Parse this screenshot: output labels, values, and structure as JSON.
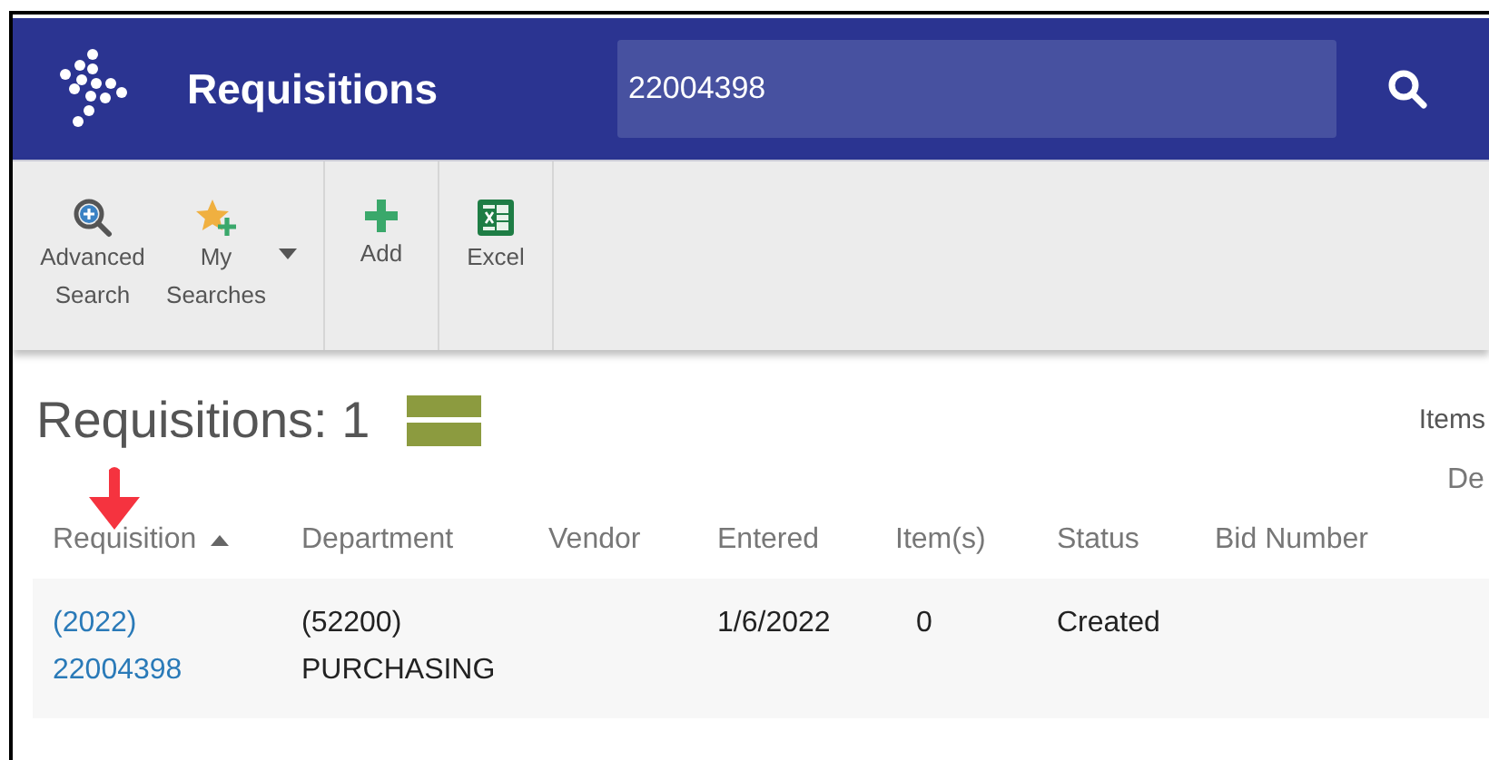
{
  "header": {
    "title": "Requisitions",
    "search": {
      "value": "22004398"
    }
  },
  "toolbar": {
    "groups": [
      {
        "buttons": [
          {
            "kind": "advanced-search",
            "label": [
              "Advanced",
              "Search"
            ]
          },
          {
            "kind": "my-searches",
            "label": [
              "My",
              "Searches"
            ],
            "dropdown": true
          }
        ]
      },
      {
        "buttons": [
          {
            "kind": "add",
            "label": [
              "Add"
            ]
          }
        ]
      },
      {
        "buttons": [
          {
            "kind": "excel",
            "label": [
              "Excel"
            ]
          }
        ]
      }
    ]
  },
  "results": {
    "title": "Requisitions: 1",
    "items_label": "Items"
  },
  "table": {
    "columns": [
      {
        "label": "Requisition",
        "sorted_ascending": true
      },
      {
        "label": "Department"
      },
      {
        "label": "Vendor"
      },
      {
        "label": "Entered"
      },
      {
        "label": "Item(s)"
      },
      {
        "label": "Status"
      },
      {
        "label": "Bid Number"
      },
      {
        "label": "De"
      }
    ],
    "rows": [
      {
        "cells": [
          {
            "kind": "link",
            "lines": [
              "(2022)",
              "22004398"
            ]
          },
          {
            "kind": "text",
            "lines": [
              "(52200)",
              "PURCHASING"
            ]
          },
          {
            "kind": "empty"
          },
          {
            "kind": "text",
            "lines": [
              "1/6/2022"
            ]
          },
          {
            "kind": "center",
            "lines": [
              "0"
            ]
          },
          {
            "kind": "text",
            "lines": [
              "Created"
            ]
          },
          {
            "kind": "empty"
          },
          {
            "kind": "empty"
          }
        ]
      }
    ]
  }
}
